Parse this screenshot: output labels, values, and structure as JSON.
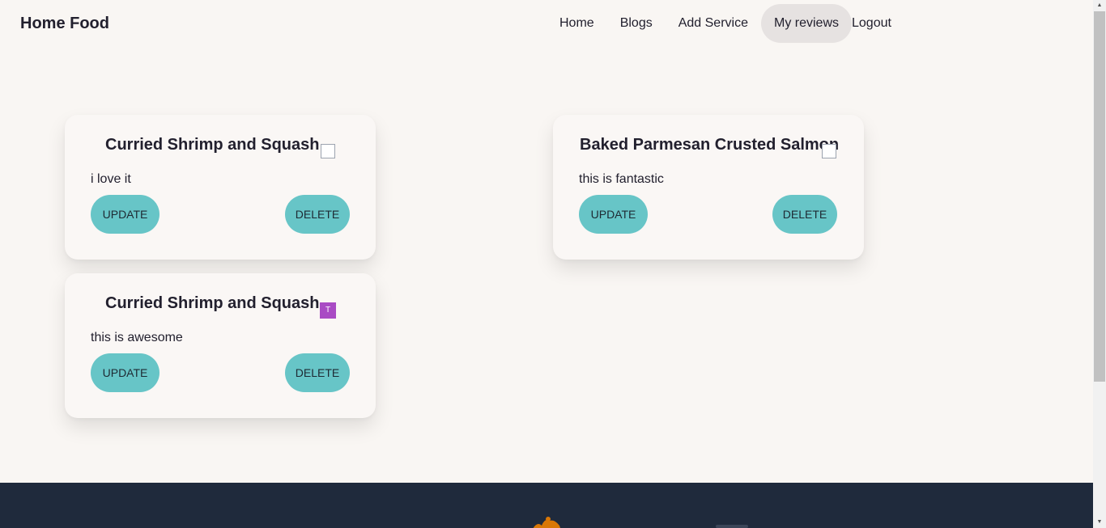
{
  "navbar": {
    "brand": "Home Food",
    "links": [
      "Home",
      "Blogs",
      "Add Service",
      "My reviews",
      "Logout"
    ],
    "active": "My reviews"
  },
  "reviews": [
    {
      "title": "Curried Shrimp and Squash",
      "text": "i love it",
      "update": "UPDATE",
      "delete": "DELETE"
    },
    {
      "title": "Baked Parmesan Crusted Salmon",
      "text": "this is fantastic",
      "update": "UPDATE",
      "delete": "DELETE"
    },
    {
      "title": "Curried Shrimp and Squash",
      "text": "this is awesome",
      "update": "UPDATE",
      "delete": "DELETE",
      "avatar_letter": "T"
    }
  ],
  "colors": {
    "accent": "#67c5c7",
    "footer": "#1f2a3c",
    "background": "#f9f6f3",
    "avatar": "#a94bc4"
  },
  "icons": {
    "footer_logo": "logo-icon"
  }
}
